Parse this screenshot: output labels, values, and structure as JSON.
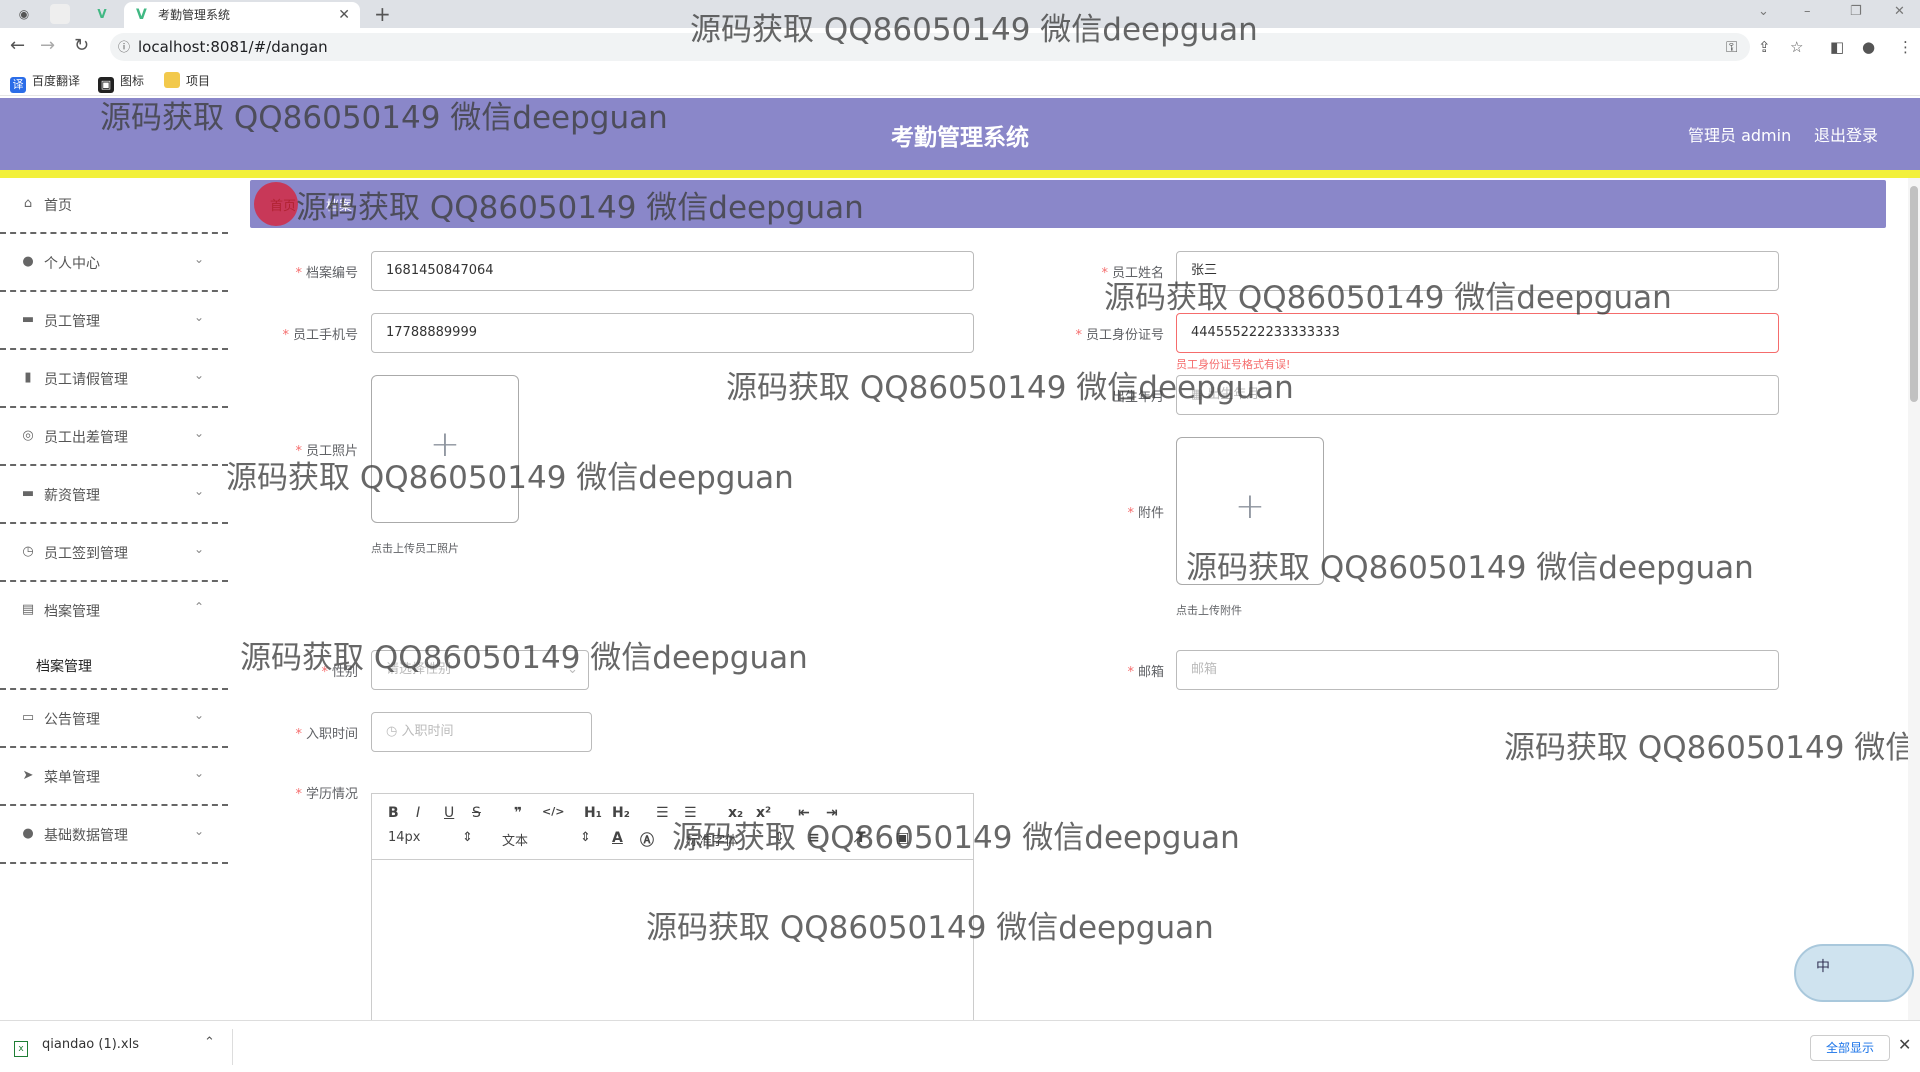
{
  "browser": {
    "tab_title": "考勤管理系统",
    "url": "localhost:8081/#/dangan",
    "bookmarks": [
      "百度翻译",
      "图标",
      "项目"
    ]
  },
  "header": {
    "title": "考勤管理系统",
    "user": "管理员 admin",
    "logout": "退出登录"
  },
  "sidebar": {
    "items": [
      {
        "label": "首页",
        "icon": "home-icon"
      },
      {
        "label": "个人中心",
        "icon": "user-icon"
      },
      {
        "label": "员工管理",
        "icon": "briefcase-icon"
      },
      {
        "label": "员工请假管理",
        "icon": "bar-chart-icon"
      },
      {
        "label": "员工出差管理",
        "icon": "compass-icon"
      },
      {
        "label": "薪资管理",
        "icon": "briefcase-icon"
      },
      {
        "label": "员工签到管理",
        "icon": "clock-icon"
      },
      {
        "label": "档案管理",
        "icon": "document-icon"
      },
      {
        "label": "公告管理",
        "icon": "monitor-icon"
      },
      {
        "label": "菜单管理",
        "icon": "send-icon"
      },
      {
        "label": "基础数据管理",
        "icon": "user-icon"
      }
    ],
    "sub_item": "档案管理"
  },
  "breadcrumb": {
    "home": "首页",
    "current": "档案"
  },
  "form": {
    "archive_no_label": "档案编号",
    "archive_no": "1681450847064",
    "name_label": "员工姓名",
    "name": "张三",
    "phone_label": "员工手机号",
    "phone": "17788889999",
    "idcard_label": "员工身份证号",
    "idcard": "444555222233333333",
    "idcard_error": "员工身份证号格式有误!",
    "birth_label": "出生年月",
    "birth_placeholder": "出生年月",
    "photo_label": "员工照片",
    "photo_hint": "点击上传员工照片",
    "attach_label": "附件",
    "attach_hint": "点击上传附件",
    "gender_label": "性别",
    "gender_placeholder": "请选择性别",
    "email_label": "邮箱",
    "email_placeholder": "邮箱",
    "hire_label": "入职时间",
    "hire_placeholder": "入职时间",
    "edu_label": "学历情况"
  },
  "editor": {
    "font_size": "14px",
    "text_type": "文本",
    "font_family": "标准字体"
  },
  "downloads": {
    "file": "qiandao (1).xls",
    "show_all": "全部显示"
  },
  "widget": {
    "label": "中"
  },
  "watermark": "源码获取 QQ86050149 微信deepguan"
}
